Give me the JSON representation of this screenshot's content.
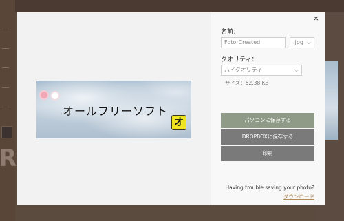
{
  "dialog": {
    "close_glyph": "×",
    "name_label": "名前：",
    "name_value": "FotorCreated",
    "format_value": ".jpg",
    "quality_label": "クオリティ：",
    "quality_value": "ハイクオリティ",
    "size_text": "サイズ：52.38 KB",
    "save_pc_label": "パソコンに保存する",
    "save_dropbox_label": "DROPBOXに保存する",
    "print_label": "印刷",
    "trouble_text": "Having trouble saving your photo?",
    "download_link": "ダウンロード"
  },
  "preview": {
    "image_text": "オールフリーソフト",
    "badge_text": "オ"
  },
  "colors": {
    "save_pc_button": "#8f9b86",
    "secondary_buttons": "#7a7a7a",
    "link": "#b18b56"
  }
}
